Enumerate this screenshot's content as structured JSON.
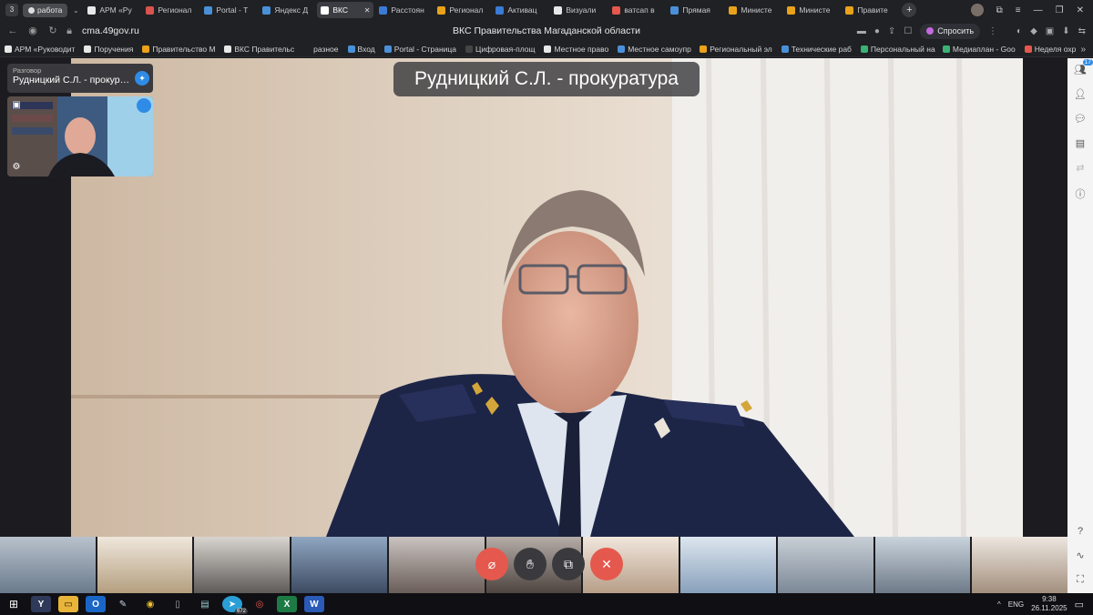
{
  "browser": {
    "workspace_badge": "3",
    "group_label": "работа",
    "tabs": [
      {
        "label": "АРМ «Ру",
        "color": "#e8e8e8"
      },
      {
        "label": "Регионал",
        "color": "#d9534f"
      },
      {
        "label": "Portal - Т",
        "color": "#4a90d9"
      },
      {
        "label": "Яндекс Д",
        "color": "#4a90d9"
      },
      {
        "label": "ВКС",
        "color": "#ffffff",
        "active": true
      },
      {
        "label": "Расстоян",
        "color": "#3a7bd5"
      },
      {
        "label": "Регионал",
        "color": "#e9a21a"
      },
      {
        "label": "Активац",
        "color": "#3a7bd5"
      },
      {
        "label": "Визуали",
        "color": "#e8e8e8"
      },
      {
        "label": "ватсап в",
        "color": "#e5584d"
      },
      {
        "label": "Прямая",
        "color": "#4a90d9"
      },
      {
        "label": "Министе",
        "color": "#e9a21a"
      },
      {
        "label": "Министе",
        "color": "#e9a21a"
      },
      {
        "label": "Правите",
        "color": "#e9a21a"
      }
    ],
    "url": "cma.49gov.ru",
    "page_title": "ВКС Правительства Магаданской области",
    "ask_label": "Спросить",
    "bookmarks": [
      {
        "label": "АРМ «Руководит",
        "color": "#e8e8e8"
      },
      {
        "label": "Поручения",
        "color": "#e8e8e8"
      },
      {
        "label": "Правительство М",
        "color": "#e9a21a"
      },
      {
        "label": "ВКС Правительс",
        "color": "#e8e8e8"
      },
      {
        "label": "разное",
        "color": "#202124"
      },
      {
        "label": "Вход",
        "color": "#4a90d9"
      },
      {
        "label": "Portal - Страница",
        "color": "#4a90d9"
      },
      {
        "label": "Цифровая-площ",
        "color": "#444"
      },
      {
        "label": "Местное право",
        "color": "#e8e8e8"
      },
      {
        "label": "Местное самоупр",
        "color": "#4a90d9"
      },
      {
        "label": "Региональный эл",
        "color": "#e9a21a"
      },
      {
        "label": "Технические раб",
        "color": "#4a90d9"
      },
      {
        "label": "Персональный на",
        "color": "#3bb273"
      },
      {
        "label": "Медиаплан - Goo",
        "color": "#3bb273"
      },
      {
        "label": "Неделя охр",
        "color": "#e5584d"
      }
    ]
  },
  "call": {
    "speaker_name": "Рудницкий С.Л. - прокуратура",
    "mini_caption": "Разговор",
    "mini_name": "Рудницкий С.Л. - прокура...",
    "sidebar_badge": "17"
  },
  "taskbar": {
    "telegram_badge": "672",
    "lang": "ENG",
    "time": "9:38",
    "date": "26.11.2025"
  }
}
